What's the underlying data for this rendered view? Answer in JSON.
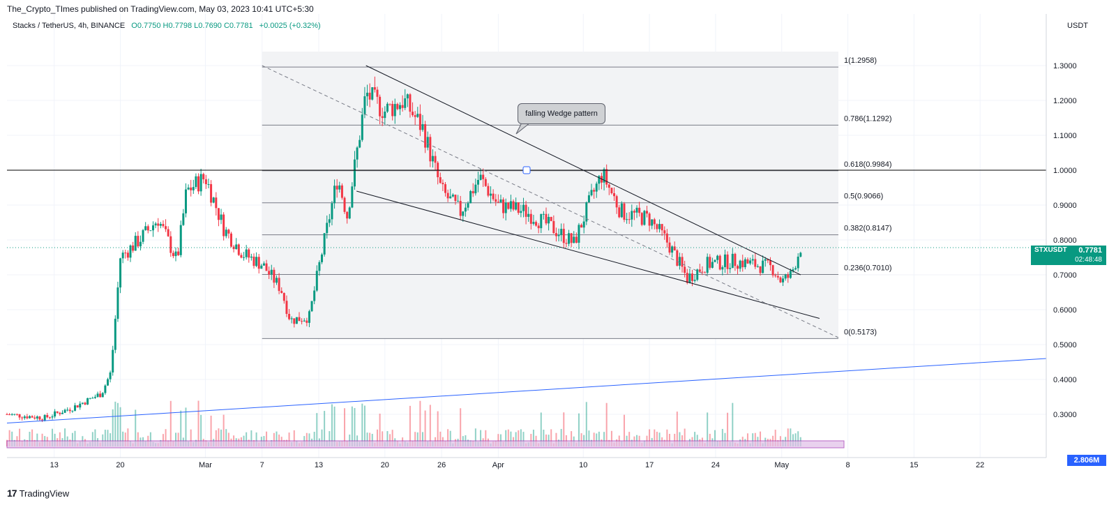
{
  "header": {
    "published_line": "The_Crypto_TImes published on TradingView.com, May 03, 2023 10:41 UTC+5:30",
    "symbol_desc": "Stacks / TetherUS, 4h, BINANCE",
    "ohlc": "O0.7750 H0.7798 L0.7690 C0.7781",
    "change": "+0.0025 (+0.32%)",
    "unit": "USDT"
  },
  "price_tag": {
    "symbol": "STXUSDT",
    "value": "0.7781",
    "timer": "02:48:48"
  },
  "volume_tag": "2.806M",
  "annotation": {
    "text": "falling Wedge pattern"
  },
  "footer": {
    "brand": "TradingView",
    "logo": "17"
  },
  "colors": {
    "up": "#089981",
    "down": "#f23645",
    "fib": "#787b86",
    "trend": "#2962ff",
    "zone": "#e1bee7"
  },
  "chart_data": {
    "type": "candlestick",
    "timeframe": "4h",
    "last_close": 0.7781,
    "y_axis": {
      "ticks": [
        "1.3000",
        "1.2000",
        "1.1000",
        "1.0000",
        "0.9000",
        "0.8000",
        "0.7000",
        "0.6000",
        "0.5000",
        "0.4000",
        "0.3000"
      ],
      "range": [
        0.28,
        1.34
      ],
      "side": "right"
    },
    "x_axis": {
      "ticks": [
        "13",
        "20",
        "Mar",
        "7",
        "13",
        "20",
        "26",
        "Apr",
        "10",
        "17",
        "24",
        "May",
        "8",
        "15",
        "22"
      ],
      "start": "2023-02-08",
      "end": "2023-05-29"
    },
    "fibonacci": [
      {
        "label": "1(1.2958)",
        "level": 1.2958
      },
      {
        "label": "0.786(1.1292)",
        "level": 1.1292
      },
      {
        "label": "0.618(0.9984)",
        "level": 0.9984
      },
      {
        "label": "0.5(0.9066)",
        "level": 0.9066
      },
      {
        "label": "0.382(0.8147)",
        "level": 0.8147
      },
      {
        "label": "0.236(0.7010)",
        "level": 0.701
      },
      {
        "label": "0(0.5173)",
        "level": 0.5173
      }
    ],
    "horizontal_line": 1.0,
    "price_path": [
      [
        "2023-02-08",
        0.3
      ],
      [
        "2023-02-12",
        0.29
      ],
      [
        "2023-02-15",
        0.32
      ],
      [
        "2023-02-18",
        0.36
      ],
      [
        "2023-02-19",
        0.42
      ],
      [
        "2023-02-20",
        0.75
      ],
      [
        "2023-02-22",
        0.8
      ],
      [
        "2023-02-24",
        0.86
      ],
      [
        "2023-02-26",
        0.74
      ],
      [
        "2023-02-27",
        0.94
      ],
      [
        "2023-03-01",
        0.98
      ],
      [
        "2023-03-03",
        0.83
      ],
      [
        "2023-03-05",
        0.76
      ],
      [
        "2023-03-07",
        0.73
      ],
      [
        "2023-03-09",
        0.66
      ],
      [
        "2023-03-10",
        0.57
      ],
      [
        "2023-03-12",
        0.58
      ],
      [
        "2023-03-13",
        0.72
      ],
      [
        "2023-03-15",
        0.98
      ],
      [
        "2023-03-16",
        0.87
      ],
      [
        "2023-03-18",
        1.22
      ],
      [
        "2023-03-20",
        1.17
      ],
      [
        "2023-03-22",
        1.2
      ],
      [
        "2023-03-24",
        1.12
      ],
      [
        "2023-03-26",
        0.94
      ],
      [
        "2023-03-28",
        0.88
      ],
      [
        "2023-03-30",
        0.98
      ],
      [
        "2023-04-01",
        0.9
      ],
      [
        "2023-04-04",
        0.88
      ],
      [
        "2023-04-07",
        0.83
      ],
      [
        "2023-04-09",
        0.79
      ],
      [
        "2023-04-11",
        0.93
      ],
      [
        "2023-04-12",
        0.99
      ],
      [
        "2023-04-14",
        0.88
      ],
      [
        "2023-04-17",
        0.86
      ],
      [
        "2023-04-19",
        0.79
      ],
      [
        "2023-04-21",
        0.69
      ],
      [
        "2023-04-23",
        0.73
      ],
      [
        "2023-04-26",
        0.74
      ],
      [
        "2023-04-28",
        0.73
      ],
      [
        "2023-04-30",
        0.72
      ],
      [
        "2023-05-01",
        0.68
      ],
      [
        "2023-05-02",
        0.7
      ],
      [
        "2023-05-03",
        0.78
      ]
    ],
    "wedge": {
      "upper": [
        [
          "2023-03-18",
          1.3
        ],
        [
          "2023-05-03",
          0.7
        ]
      ],
      "lower": [
        [
          "2023-03-17",
          0.94
        ],
        [
          "2023-05-05",
          0.575
        ]
      ],
      "mid_dashed": [
        [
          "2023-03-07",
          1.3
        ],
        [
          "2023-05-07",
          0.52
        ]
      ]
    },
    "support_trendline": [
      [
        "2023-02-08",
        0.275
      ],
      [
        "2023-05-29",
        0.46
      ]
    ]
  }
}
